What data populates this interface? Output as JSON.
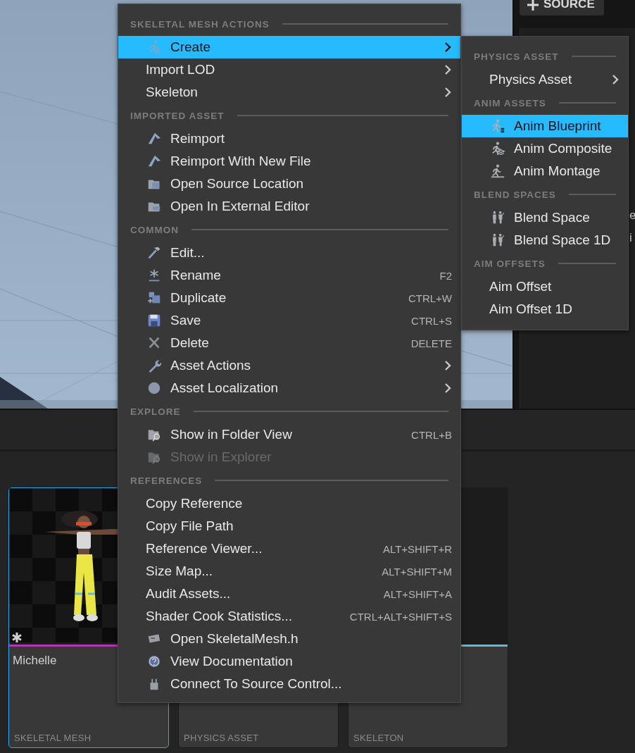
{
  "menu": {
    "sections": [
      {
        "title": "SKELETAL MESH ACTIONS",
        "items": [
          {
            "label": "Create",
            "submenu": true,
            "selected": true,
            "disabled": false
          },
          {
            "label": "Import LOD",
            "submenu": true,
            "selected": false,
            "disabled": false
          },
          {
            "label": "Skeleton",
            "submenu": true,
            "selected": false,
            "disabled": false
          }
        ]
      },
      {
        "title": "IMPORTED ASSET",
        "items": [
          {
            "label": "Reimport",
            "selected": false,
            "disabled": false
          },
          {
            "label": "Reimport With New File",
            "selected": false,
            "disabled": false
          },
          {
            "label": "Open Source Location",
            "selected": false,
            "disabled": false
          },
          {
            "label": "Open In External Editor",
            "selected": false,
            "disabled": false
          }
        ]
      },
      {
        "title": "COMMON",
        "items": [
          {
            "label": "Edit...",
            "selected": false,
            "disabled": false
          },
          {
            "label": "Rename",
            "shortcut": "F2",
            "selected": false,
            "disabled": false
          },
          {
            "label": "Duplicate",
            "shortcut": "CTRL+W",
            "selected": false,
            "disabled": false
          },
          {
            "label": "Save",
            "shortcut": "CTRL+S",
            "selected": false,
            "disabled": false
          },
          {
            "label": "Delete",
            "shortcut": "DELETE",
            "selected": false,
            "disabled": false
          },
          {
            "label": "Asset Actions",
            "submenu": true,
            "selected": false,
            "disabled": false
          },
          {
            "label": "Asset Localization",
            "submenu": true,
            "selected": false,
            "disabled": false
          }
        ]
      },
      {
        "title": "EXPLORE",
        "items": [
          {
            "label": "Show in Folder View",
            "shortcut": "CTRL+B",
            "selected": false,
            "disabled": false
          },
          {
            "label": "Show in Explorer",
            "selected": false,
            "disabled": true
          }
        ]
      },
      {
        "title": "REFERENCES",
        "items": [
          {
            "label": "Copy Reference",
            "selected": false,
            "disabled": false
          },
          {
            "label": "Copy File Path",
            "selected": false,
            "disabled": false
          },
          {
            "label": "Reference Viewer...",
            "shortcut": "ALT+SHIFT+R",
            "selected": false,
            "disabled": false
          },
          {
            "label": "Size Map...",
            "shortcut": "ALT+SHIFT+M",
            "selected": false,
            "disabled": false
          },
          {
            "label": "Audit Assets...",
            "shortcut": "ALT+SHIFT+A",
            "selected": false,
            "disabled": false
          },
          {
            "label": "Shader Cook Statistics...",
            "shortcut": "CTRL+ALT+SHIFT+S",
            "selected": false,
            "disabled": false
          },
          {
            "label": "Open SkeletalMesh.h",
            "selected": false,
            "disabled": false
          },
          {
            "label": "View Documentation",
            "selected": false,
            "disabled": false
          },
          {
            "label": "Connect To Source Control...",
            "selected": false,
            "disabled": false
          }
        ]
      }
    ]
  },
  "submenu": {
    "sections": [
      {
        "title": "PHYSICS ASSET",
        "items": [
          {
            "label": "Physics Asset",
            "submenu": true,
            "selected": false,
            "disabled": false
          }
        ]
      },
      {
        "title": "ANIM ASSETS",
        "items": [
          {
            "label": "Anim Blueprint",
            "selected": true,
            "disabled": false
          },
          {
            "label": "Anim Composite",
            "selected": false,
            "disabled": false
          },
          {
            "label": "Anim Montage",
            "selected": false,
            "disabled": false
          }
        ]
      },
      {
        "title": "BLEND SPACES",
        "items": [
          {
            "label": "Blend Space",
            "selected": false,
            "disabled": false
          },
          {
            "label": "Blend Space 1D",
            "selected": false,
            "disabled": false
          }
        ]
      },
      {
        "title": "AIM OFFSETS",
        "items": [
          {
            "label": "Aim Offset",
            "selected": false,
            "disabled": false
          },
          {
            "label": "Aim Offset 1D",
            "selected": false,
            "disabled": false
          }
        ]
      }
    ]
  },
  "source_button": {
    "label": "SOURCE"
  },
  "side_panel": {
    "fragments": [
      "e",
      "i"
    ]
  },
  "assets": [
    {
      "kind": "picture",
      "name": "Michelle",
      "type": "SKELETAL MESH",
      "color": "#ff00ff",
      "selected": true
    },
    {
      "type": "PHYSICS ASSET",
      "selected": false
    },
    {
      "type": "SKELETON",
      "color": "#5fb8d8",
      "selected": false
    }
  ]
}
